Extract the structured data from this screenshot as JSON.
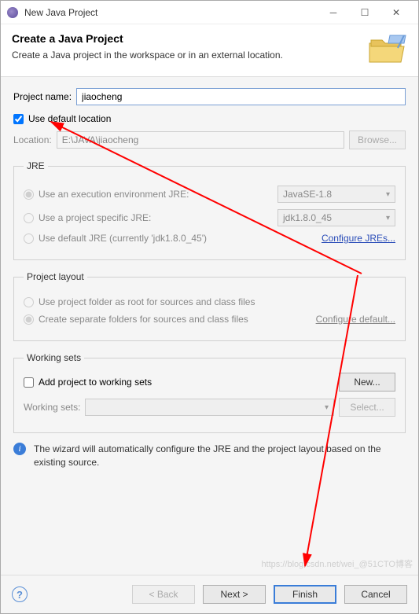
{
  "window": {
    "title": "New Java Project"
  },
  "header": {
    "title": "Create a Java Project",
    "subtitle": "Create a Java project in the workspace or in an external location."
  },
  "form": {
    "projectNameLabel": "Project name:",
    "projectNameValue": "jiaocheng",
    "useDefaultLocationLabel": "Use default location",
    "useDefaultLocationChecked": true,
    "locationLabel": "Location:",
    "locationValue": "E:\\JAVA\\jiaocheng",
    "browseLabel": "Browse..."
  },
  "jre": {
    "legend": "JRE",
    "opt1Label": "Use an execution environment JRE:",
    "opt1Select": "JavaSE-1.8",
    "opt2Label": "Use a project specific JRE:",
    "opt2Select": "jdk1.8.0_45",
    "opt3Label": "Use default JRE (currently 'jdk1.8.0_45')",
    "configureLink": "Configure JREs..."
  },
  "layout": {
    "legend": "Project layout",
    "opt1Label": "Use project folder as root for sources and class files",
    "opt2Label": "Create separate folders for sources and class files",
    "configureLink": "Configure default..."
  },
  "workingSets": {
    "legend": "Working sets",
    "addLabel": "Add project to working sets",
    "newLabel": "New...",
    "wsLabel": "Working sets:",
    "selectLabel": "Select..."
  },
  "info": {
    "text": "The wizard will automatically configure the JRE and the project layout based on the existing source."
  },
  "footer": {
    "back": "< Back",
    "next": "Next >",
    "finish": "Finish",
    "cancel": "Cancel"
  },
  "watermark": "https://blog.csdn.net/wei_@51CTO博客"
}
